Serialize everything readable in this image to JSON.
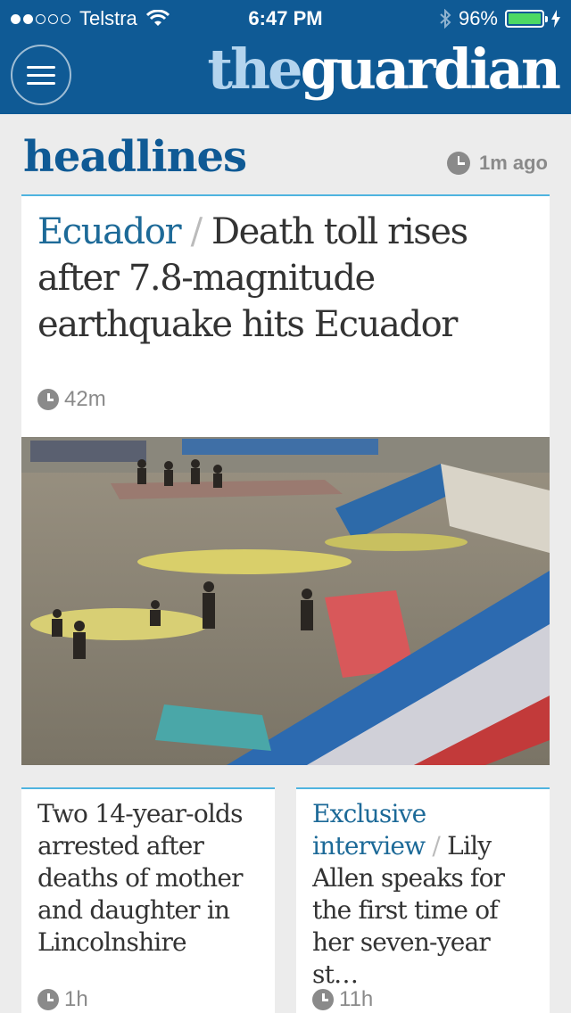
{
  "status_bar": {
    "carrier": "Telstra",
    "time": "6:47 PM",
    "battery": "96%",
    "battery_level": 0.96,
    "signal_bars": 2
  },
  "header": {
    "logo_the": "the",
    "logo_guardian": "guardian",
    "menu_icon": "hamburger-menu-icon",
    "brand_color": "#0f5a95"
  },
  "section": {
    "title": "headlines",
    "updated": "1m ago"
  },
  "main_story": {
    "kicker": "Ecuador",
    "separator": "/",
    "headline": "Death toll rises after 7.8-magnitude earthquake hits Ecuador",
    "age": "42m"
  },
  "stories": [
    {
      "kicker": "",
      "headline": "Two 14-year-olds arrested after deaths of mother and daughter in Lincolnshire",
      "age": "1h"
    },
    {
      "kicker": "Exclusive interview",
      "separator": "/",
      "headline": "Lily Allen speaks for the first time of her seven-year st…",
      "age": "11h"
    }
  ]
}
